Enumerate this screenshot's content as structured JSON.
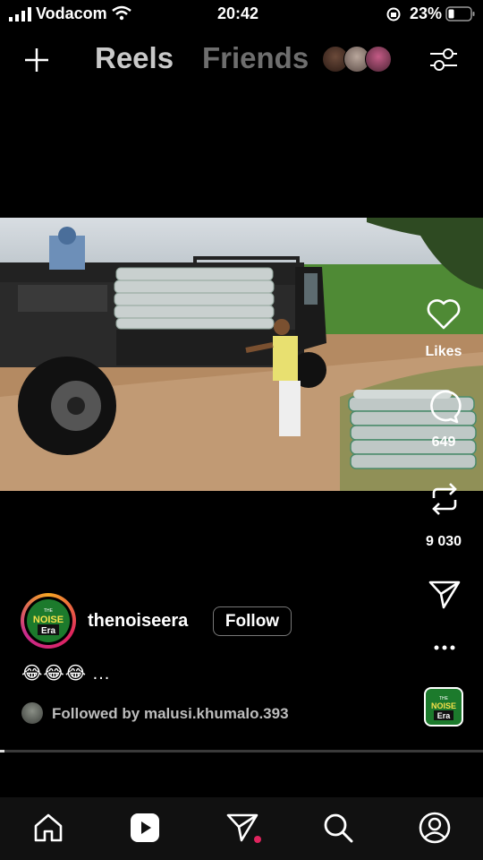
{
  "status": {
    "carrier": "Vodacom",
    "time": "20:42",
    "battery": "23%"
  },
  "header": {
    "tab_reels": "Reels",
    "tab_friends": "Friends"
  },
  "actions": {
    "likes_label": "Likes",
    "comments_count": "649",
    "reposts_count": "9 030"
  },
  "post": {
    "username": "thenoiseera",
    "follow_label": "Follow",
    "caption": "😂😂😂 ...",
    "followed_by_prefix": "Followed by",
    "followed_by_user": "malusi.khumalo.393",
    "avatar_text_top": "THE",
    "avatar_text_mid": "NOISE",
    "avatar_text_bot": "Era"
  },
  "progress": 0.01,
  "colors": {
    "brand_green": "#1c7a2c",
    "accent_red": "#e0245e",
    "ring_orange": "#f5a623",
    "ring_magenta": "#c82a8c"
  }
}
